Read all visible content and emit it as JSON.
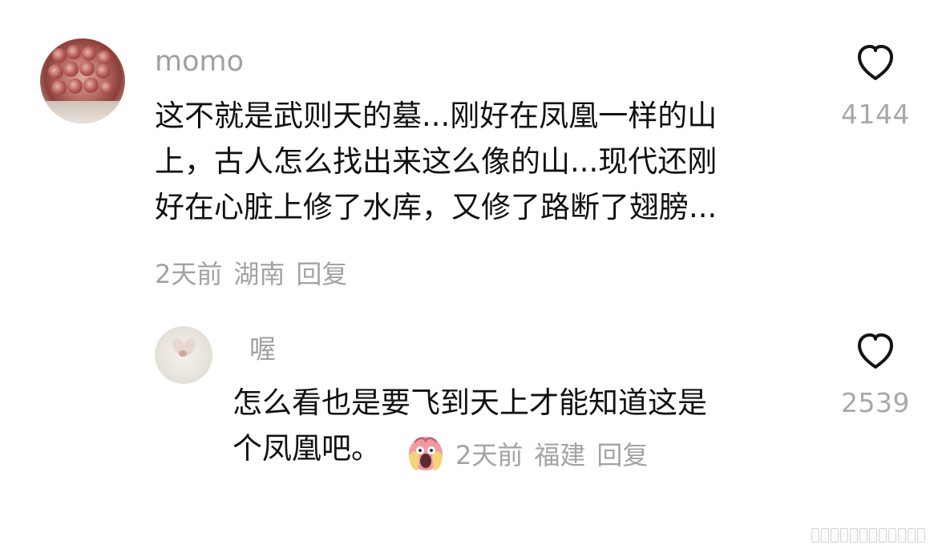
{
  "comments": {
    "main": {
      "username": "momo",
      "lines": [
        "这不就是武则天的墓...刚好在凤凰一样的山",
        "上，古人怎么找出来这么像的山...现代还刚",
        "好在心脏上修了水库，又修了路断了翅膀..."
      ],
      "time": "2天前",
      "location": "湖南",
      "reply": "回复",
      "likes": "4144"
    },
    "reply": {
      "username": "喔",
      "lines": [
        "怎么看也是要飞到天上才能知道这是",
        "个凤凰吧。"
      ],
      "emoji": "shocked-face-emoji",
      "time": "2天前",
      "location": "福建",
      "reply": "回复",
      "likes": "2539"
    }
  },
  "icons": {
    "like": "heart-icon",
    "watermark": "watermark-icon"
  },
  "colors": {
    "text": "#111111",
    "secondary": "#a3a3a3",
    "heart": "#141414",
    "emoji_face": "#f29aa2",
    "emoji_hands": "#f6d27a"
  }
}
